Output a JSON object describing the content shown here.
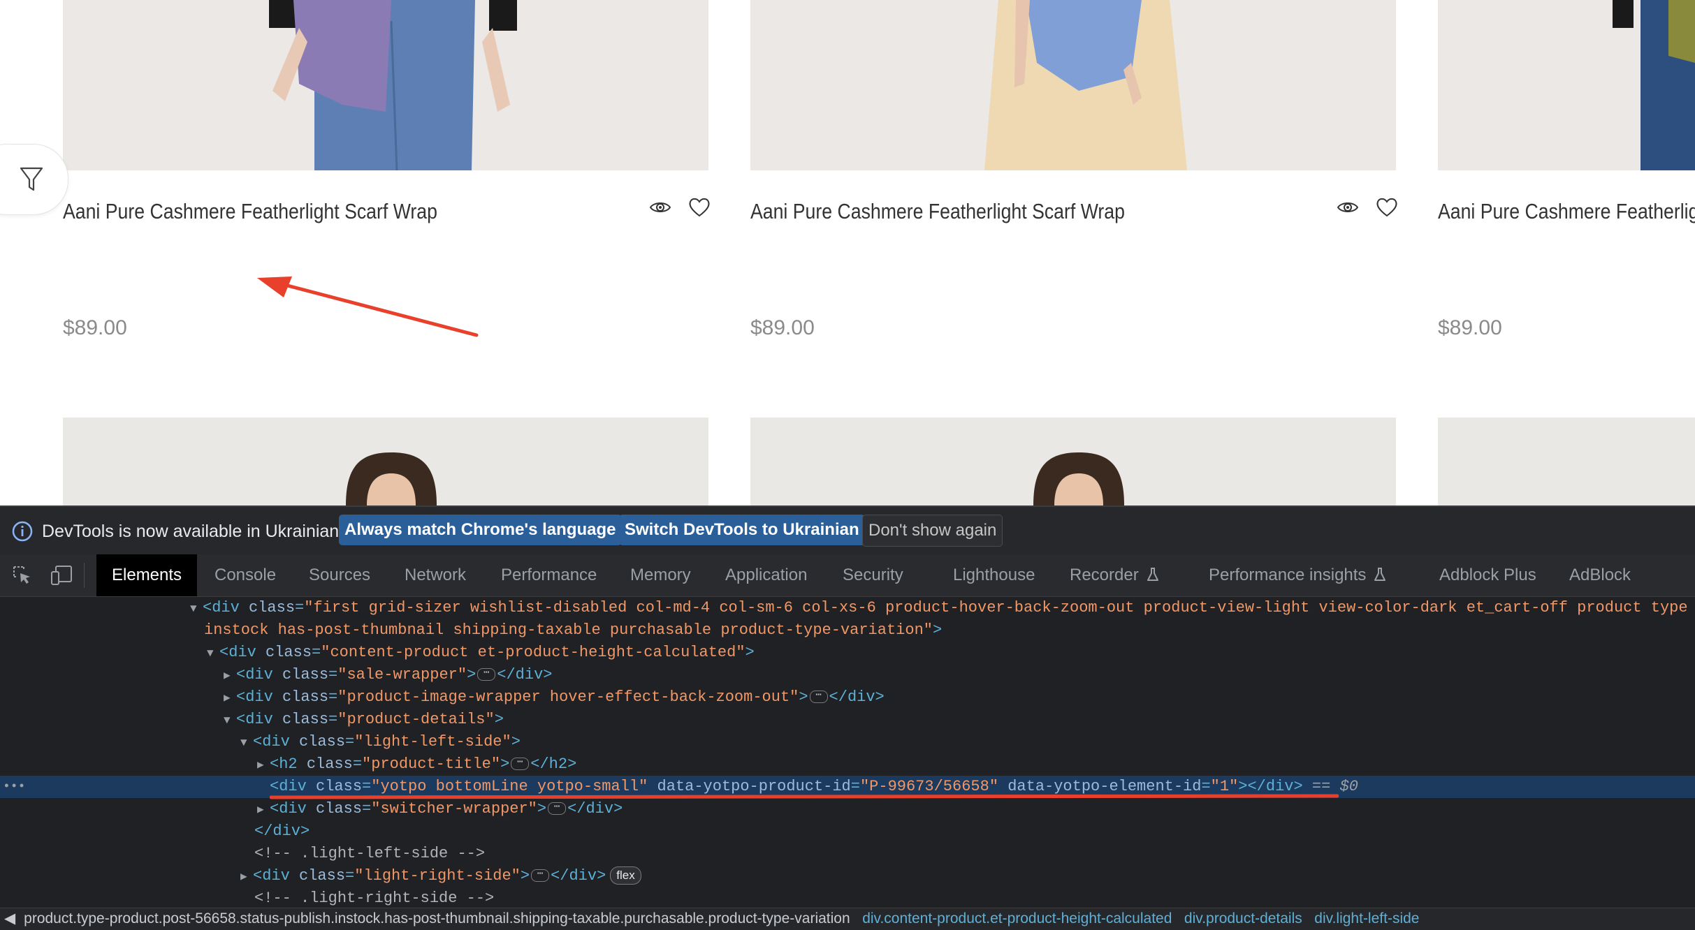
{
  "products": [
    {
      "title": "Aani Pure Cashmere Featherlight Scarf Wrap",
      "price": "$89.00",
      "scarf_color": "#8b7bb5"
    },
    {
      "title": "Aani Pure Cashmere Featherlight Scarf Wrap",
      "price": "$89.00",
      "scarf_color": "#7f9fd6"
    },
    {
      "title": "Aani Pure Cashmere Featherlight Scarf Wrap",
      "price": "$89.00",
      "scarf_color": "#8a8a3c"
    }
  ],
  "annotation_color": "#e8402a",
  "devtools": {
    "infobar": {
      "message": "DevTools is now available in Ukrainian!",
      "btn_always": "Always match Chrome's language",
      "btn_switch": "Switch DevTools to Ukrainian",
      "btn_dont_show": "Don't show again"
    },
    "tabs": [
      "Elements",
      "Console",
      "Sources",
      "Network",
      "Performance",
      "Memory",
      "Application",
      "Security",
      "Lighthouse",
      "Recorder",
      "Performance insights",
      "Adblock Plus",
      "AdBlock"
    ],
    "dom": {
      "l1_attr": "class",
      "l1_val": "first grid-sizer wishlist-disabled col-md-4 col-sm-6 col-xs-6 product-hover-back-zoom-out product-view-light view-color-dark et_cart-off product type",
      "l1_cont": "instock has-post-thumbnail shipping-taxable purchasable product-type-variation",
      "l2_val": "content-product et-product-height-calculated",
      "l3_val": "sale-wrapper",
      "l4_val": "product-image-wrapper hover-effect-back-zoom-out",
      "l5_val": "product-details",
      "l6_val": "light-left-side",
      "l7_val": "product-title",
      "l8_class": "yotpo bottomLine yotpo-small",
      "l8_attr2": "data-yotpo-product-id",
      "l8_val2": "P-99673/56658",
      "l8_attr3": "data-yotpo-element-id",
      "l8_val3": "1",
      "l8_eq": "==",
      "l8_ref": "$0",
      "l9_val": "switcher-wrapper",
      "l11_comment": "<!-- .light-left-side -->",
      "l12_val": "light-right-side",
      "l12_badge": "flex",
      "l13_comment": "<!-- .light-right-side -->"
    },
    "breadcrumbs": {
      "b1": "product.type-product.post-56658.status-publish.instock.has-post-thumbnail.shipping-taxable.purchasable.product-type-variation",
      "b2": "div.content-product.et-product-height-calculated",
      "b3": "div.product-details",
      "b4": "div.light-left-side"
    }
  }
}
